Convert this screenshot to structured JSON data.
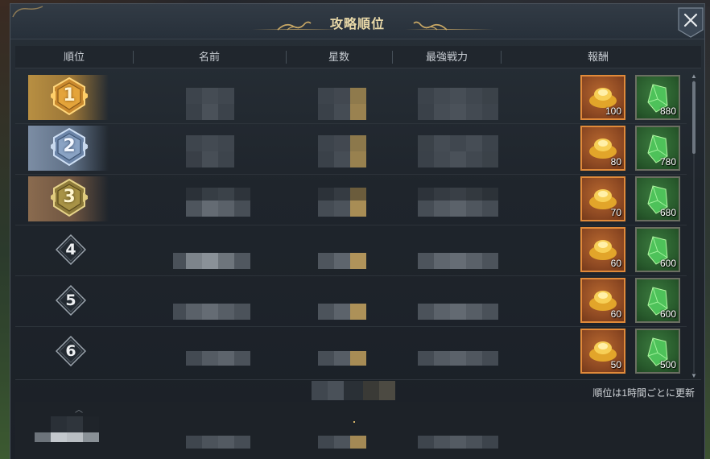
{
  "window": {
    "title": "攻略順位",
    "close_icon": "close-icon"
  },
  "columns": [
    "順位",
    "名前",
    "星数",
    "最強戦力",
    "報酬"
  ],
  "rows": [
    {
      "rank": "1",
      "badge": "gold-medal-icon",
      "rewards": [
        {
          "icon": "gold-ingot-icon",
          "qty": "100"
        },
        {
          "icon": "green-crystal-icon",
          "qty": "880"
        }
      ]
    },
    {
      "rank": "2",
      "badge": "silver-medal-icon",
      "rewards": [
        {
          "icon": "gold-ingot-icon",
          "qty": "80"
        },
        {
          "icon": "green-crystal-icon",
          "qty": "780"
        }
      ]
    },
    {
      "rank": "3",
      "badge": "bronze-medal-icon",
      "rewards": [
        {
          "icon": "gold-ingot-icon",
          "qty": "70"
        },
        {
          "icon": "green-crystal-icon",
          "qty": "680"
        }
      ]
    },
    {
      "rank": "4",
      "badge": "diamond-rank-icon",
      "rewards": [
        {
          "icon": "gold-ingot-icon",
          "qty": "60"
        },
        {
          "icon": "green-crystal-icon",
          "qty": "600"
        }
      ]
    },
    {
      "rank": "5",
      "badge": "diamond-rank-icon",
      "rewards": [
        {
          "icon": "gold-ingot-icon",
          "qty": "60"
        },
        {
          "icon": "green-crystal-icon",
          "qty": "600"
        }
      ]
    },
    {
      "rank": "6",
      "badge": "diamond-rank-icon",
      "rewards": [
        {
          "icon": "gold-ingot-icon",
          "qty": "50"
        },
        {
          "icon": "green-crystal-icon",
          "qty": "500"
        }
      ]
    }
  ],
  "footer": {
    "update_note": "順位は1時間ごとに更新"
  },
  "colors": {
    "title": "#e9d9a8",
    "gold_frame": "#e08a3a",
    "gem_frame": "#6b6f62"
  }
}
